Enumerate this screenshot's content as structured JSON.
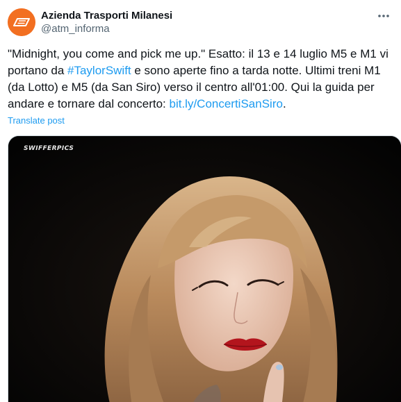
{
  "author": {
    "display_name": "Azienda Trasporti Milanesi",
    "handle": "@atm_informa",
    "avatar_icon": "atm-logo-icon",
    "avatar_color": "#f26f21"
  },
  "post": {
    "text_1": "\"Midnight, you come and pick me up.\" Esatto: il 13 e 14 luglio M5 e M1 vi portano da ",
    "hashtag": "#TaylorSwift",
    "text_2": " e sono aperte fino a tarda notte. Ultimi treni M1 (da Lotto) e M5 (da San Siro) verso il centro all'01:00. Qui la guida per andare e tornare dal concerto: ",
    "link": "bit.ly/ConcertiSanSiro",
    "text_3": "."
  },
  "actions": {
    "translate_label": "Translate post",
    "more_icon": "more-options-icon"
  },
  "media": {
    "watermark": "SWIFFERPICS"
  },
  "colors": {
    "link": "#1d9bf0",
    "secondary_text": "#536471",
    "primary_text": "#0f1419"
  }
}
